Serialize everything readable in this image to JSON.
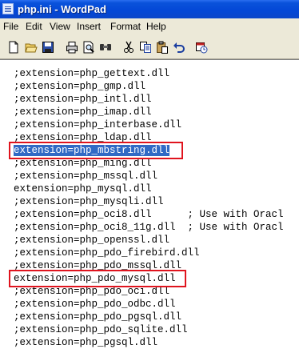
{
  "window": {
    "title": "php.ini - WordPad"
  },
  "menu": [
    "File",
    "Edit",
    "View",
    "Insert",
    "Format",
    "Help"
  ],
  "toolbar": [
    "new-document-icon",
    "open-folder-icon",
    "save-icon",
    "print-icon",
    "print-preview-icon",
    "find-icon",
    "cut-icon",
    "copy-icon",
    "paste-icon",
    "undo-icon",
    "insert-date-time-icon"
  ],
  "lines": [
    ";extension=php_gettext.dll",
    ";extension=php_gmp.dll",
    ";extension=php_intl.dll",
    ";extension=php_imap.dll",
    ";extension=php_interbase.dll",
    ";extension=php_ldap.dll",
    "extension=php_mbstring.dll",
    ";extension=php_ming.dll",
    ";extension=php_mssql.dll",
    "extension=php_mysql.dll",
    ";extension=php_mysqli.dll",
    ";extension=php_oci8.dll      ; Use with Oracl",
    ";extension=php_oci8_11g.dll  ; Use with Oracl",
    ";extension=php_openssl.dll",
    ";extension=php_pdo_firebird.dll",
    ";extension=php_pdo_mssql.dll",
    "extension=php_pdo_mysql.dll",
    ";extension=php_pdo_oci.dll",
    ";extension=php_pdo_odbc.dll",
    ";extension=php_pdo_pgsql.dll",
    ";extension=php_pdo_sqlite.dll",
    ";extension=php_pgsql.dll"
  ],
  "selected_line_index": 6,
  "highlight_line_indices": [
    6,
    16
  ],
  "colors": {
    "selection": "#316ac5",
    "highlight_box": "#e0141e",
    "titlebar": "#0a52db"
  }
}
